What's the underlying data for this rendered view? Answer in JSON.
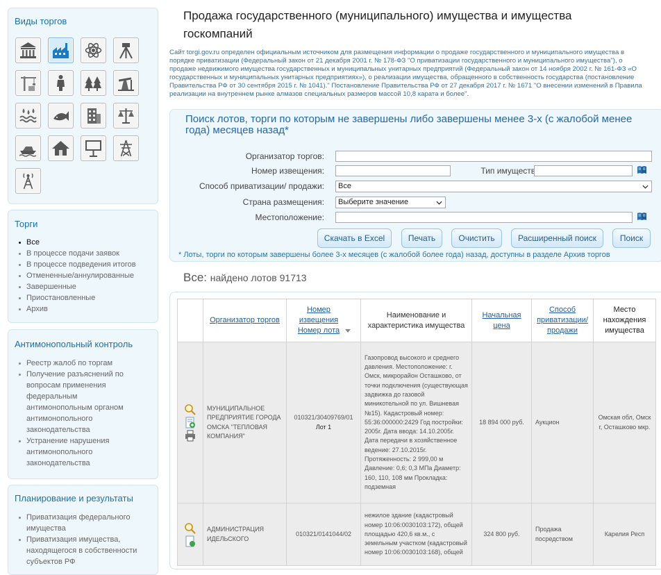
{
  "page": {
    "title": "Продажа государственного (муниципального) имущества и имущества госкомпаний"
  },
  "intro": "Сайт torgi.gov.ru определен официальным источником для размещения информации о продаже государственного и муниципального имущества в порядке приватизации (Федеральный закон от 21 декабря 2001 г. № 178-ФЗ \"О приватизации государственного и муниципального имущества\"), о продаже недвижимого имущества государственных и муниципальных унитарных предприятий (Федеральный закон от 14 ноября 2002 г. № 161-ФЗ «О государственных и муниципальных унитарных предприятиях»), о реализации имущества, обращенного в собственность государства (постановление Правительства РФ от 30 сентября 2015 г. № 1041).\" Постановление Правительства РФ от 27 декабря 2017 г. № 1671 \"О внесении изменений в Правила реализации на внутреннем рынке алмазов специальных размеров массой 10,8 карата и более\".",
  "sidebar": {
    "types_title": "Виды торгов",
    "type_icons": [
      {
        "icon": "government-building-icon"
      },
      {
        "icon": "factory-icon"
      },
      {
        "icon": "atom-icon"
      },
      {
        "icon": "surveying-instrument-icon"
      },
      {
        "icon": "construction-crane-icon"
      },
      {
        "icon": "person-monument-icon"
      },
      {
        "icon": "forest-icon"
      },
      {
        "icon": "oil-pump-icon"
      },
      {
        "icon": "water-icon"
      },
      {
        "icon": "fish-icon"
      },
      {
        "icon": "office-building-icon"
      },
      {
        "icon": "scales-icon"
      },
      {
        "icon": "boat-icon"
      },
      {
        "icon": "house-icon"
      },
      {
        "icon": "billboard-icon"
      },
      {
        "icon": "power-line-icon"
      },
      {
        "icon": "radio-tower-icon"
      }
    ],
    "trades_title": "Торги",
    "trades": [
      {
        "label": "Все"
      },
      {
        "label": "В процессе подачи заявок"
      },
      {
        "label": "В процессе подведения итогов"
      },
      {
        "label": "Отмененные/аннулированные"
      },
      {
        "label": "Завершенные"
      },
      {
        "label": "Приостановленные"
      },
      {
        "label": "Архив"
      }
    ],
    "antimonopoly_title": "Антимонопольный контроль",
    "antimonopoly": [
      {
        "label": "Реестр жалоб по торгам"
      },
      {
        "label": "Получение разъяснений по вопросам применения федеральным антимонопольным органом антимонопольного законодательства"
      },
      {
        "label": "Устранение нарушения антимонопольного законодательства"
      }
    ],
    "planning_title": "Планирование и результаты",
    "planning": [
      {
        "label": "Приватизация федерального имущества"
      },
      {
        "label": "Приватизация имущества, находящегося в собственности субъектов РФ"
      }
    ]
  },
  "search": {
    "title": "Поиск лотов, торги по которым не завершены либо завершены менее 3-х (с жалобой менее года) месяцев назад*",
    "organizer_label": "Организатор торгов:",
    "organizer_value": "",
    "notice_label": "Номер извещения:",
    "notice_value": "",
    "property_type_label": "Тип имущества:",
    "property_type_value": "",
    "method_label": "Способ приватизации/ продажи:",
    "method_value": "Все",
    "country_label": "Страна размещения:",
    "country_value": "Выберите значение",
    "location_label": "Местоположение:",
    "location_value": "",
    "buttons": {
      "excel": "Скачать в Excel",
      "print": "Печать",
      "clear": "Очистить",
      "advanced": "Расширенный поиск",
      "search": "Поиск"
    },
    "note": "* Лоты, торги по которым завершены более 3-х месяцев (с жалобой более года) назад, доступны в разделе Архив торгов"
  },
  "results": {
    "prefix": "Все:",
    "count_text": "найдено лотов 91713",
    "columns": {
      "organizer": "Организатор торгов",
      "number": "Номер извещения Номер лота",
      "description": "Наименование и характеристика имущества",
      "price": "Начальная цена",
      "method": "Способ приватизации/ продажи",
      "place": "Место нахождения имущества"
    },
    "rows": [
      {
        "organizer": "МУНИЦИПАЛЬНОЕ ПРЕДПРИЯТИЕ ГОРОДА ОМСКА \"ТЕПЛОВАЯ КОМПАНИЯ\"",
        "notice": "010321/30409769/01",
        "lot": "Лот 1",
        "description": "Газопровод высокого и среднего давления. Местоположение: г. Омск, микрорайон Осташково, от точки подключения (существующая задвижка до газовой миникотельной по ул. Вишневая №15). Кадастровый номер: 55:36:000000:2429 Год постройки: 2005г. Дата ввода: 14.10.2005г. Дата передачи в хозяйственное ведение: 27.10.2015г. Протяженность: 2 999,00 м Давление: 0,6; 0,3 МПа Диаметр: 160, 110, 108 мм Прокладка: подземная",
        "price": "18 894 000 руб.",
        "method": "Аукцион",
        "place": "Омская обл, Омск г, Осташково мкр."
      },
      {
        "organizer": "АДМИНИСТРАЦИЯ ИДЕЛЬСКОГО",
        "notice": "010321/0141044/02",
        "lot": "",
        "description": "нежилое здание (кадастровый номер 10:06:0030103:172), общей площадью 420,6 кв.м., с земельным участком (кадастровый номер 10:06:0030103:168), общей",
        "price": "324 800 руб.",
        "method": "Продажа посредством",
        "place": "Карелия Респ"
      }
    ]
  }
}
